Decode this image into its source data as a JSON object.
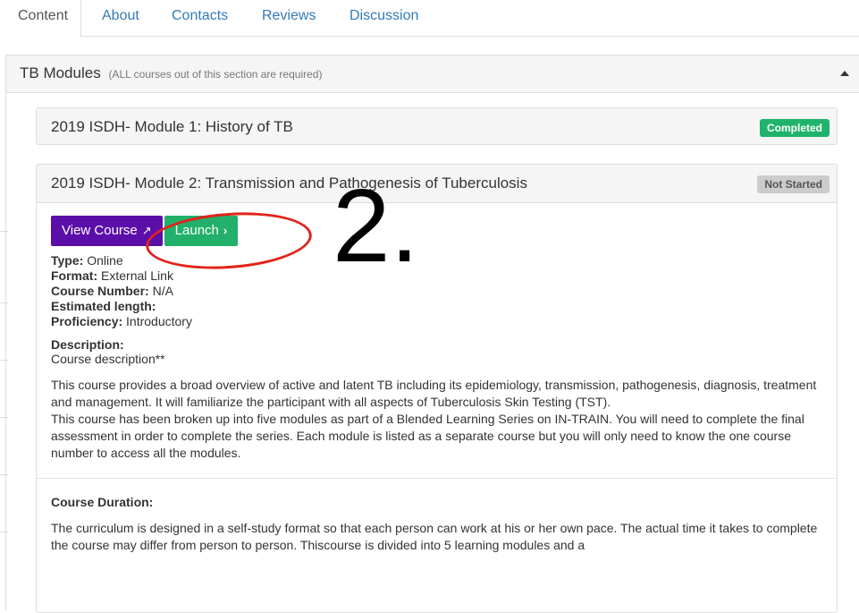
{
  "tabs": [
    {
      "label": "Content",
      "active": true
    },
    {
      "label": "About"
    },
    {
      "label": "Contacts"
    },
    {
      "label": "Reviews"
    },
    {
      "label": "Discussion"
    }
  ],
  "section": {
    "title": "TB Modules",
    "note": "(ALL courses out of this section are required)"
  },
  "modules": [
    {
      "title": "2019 ISDH- Module 1: History of TB",
      "status": "Completed"
    },
    {
      "title": "2019 ISDH- Module 2: Transmission and Pathogenesis of Tuberculosis",
      "status": "Not Started",
      "view_button": "View Course",
      "launch_button": "Launch",
      "details": [
        {
          "label": "Type:",
          "value": "Online"
        },
        {
          "label": "Format:",
          "value": "External Link"
        },
        {
          "label": "Course Number:",
          "value": "N/A"
        },
        {
          "label": "Estimated length:",
          "value": ""
        },
        {
          "label": "Proficiency:",
          "value": "Introductory"
        }
      ],
      "description_heading": "Description:",
      "description_intro": "Course description**",
      "paragraph1": "This course provides a broad overview of active and latent TB including its epidemiology, transmission, pathogenesis, diagnosis, treatment and management. It will familiarize the participant with all aspects of Tuberculosis Skin Testing (TST).",
      "paragraph2": "This course has been broken up into five modules as part of a Blended Learning Series on IN-TRAIN. You will need to complete the final assessment in order to complete the series. Each module is listed as a separate course but you will only need to know the one course number to access all the modules.",
      "duration_heading": "Course Duration:",
      "duration_text": "The curriculum is designed in a self-study format so that each person can work at his or her own pace. The actual time it takes to complete the course    may differ from person to person. Thiscourse is divided into 5 learning modules and a"
    }
  ],
  "annotation": {
    "number": "2."
  },
  "colors": {
    "link": "#337ab7",
    "completed": "#1fb36b",
    "not_started": "#cccccc",
    "view_button": "#5b0fa8",
    "launch_button": "#22b06a",
    "annotation_ring": "#e2231a"
  }
}
